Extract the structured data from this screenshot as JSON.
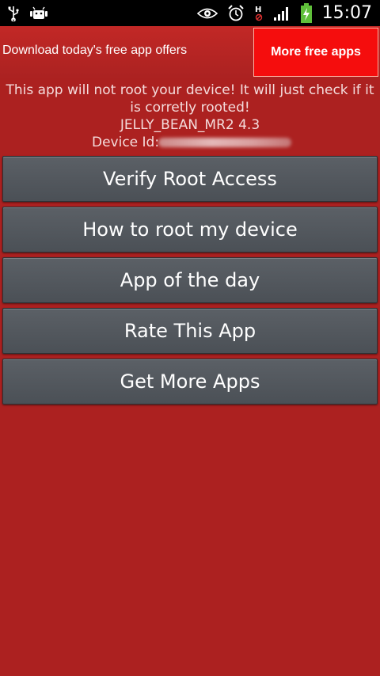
{
  "statusbar": {
    "time": "15:07",
    "icons": [
      "usb-icon",
      "android-debug-icon",
      "eye-icon",
      "alarm-icon",
      "hspa-icon",
      "signal-icon",
      "battery-charging-icon"
    ]
  },
  "banner": {
    "text": "Download today's free app offers",
    "button_label": "More free apps"
  },
  "info": {
    "line1": "This app will not root your device! It will just check if it is corretly rooted!",
    "version": "JELLY_BEAN_MR2 4.3",
    "device_id_label": "Device Id:"
  },
  "menu": {
    "items": [
      {
        "label": "Verify Root Access"
      },
      {
        "label": "How to root my device"
      },
      {
        "label": "App of the day"
      },
      {
        "label": "Rate This App"
      },
      {
        "label": "Get More Apps"
      }
    ]
  }
}
